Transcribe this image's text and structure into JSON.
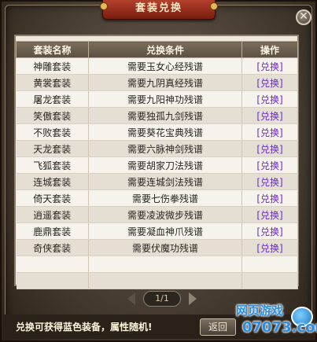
{
  "window": {
    "title": "套装兑换",
    "close_symbol": "✕"
  },
  "table": {
    "headers": [
      "套装名称",
      "兑换条件",
      "操作"
    ],
    "rows": [
      {
        "name": "神雕套装",
        "condition": "需要玉女心经残谱",
        "action": "[兑换]"
      },
      {
        "name": "黄裳套装",
        "condition": "需要九阴真经残谱",
        "action": "[兑换]"
      },
      {
        "name": "屠龙套装",
        "condition": "需要九阳神功残谱",
        "action": "[兑换]"
      },
      {
        "name": "笑傲套装",
        "condition": "需要独孤九剑残谱",
        "action": "[兑换]"
      },
      {
        "name": "不败套装",
        "condition": "需要葵花宝典残谱",
        "action": "[兑换]"
      },
      {
        "name": "天龙套装",
        "condition": "需要六脉神剑残谱",
        "action": "[兑换]"
      },
      {
        "name": "飞狐套装",
        "condition": "需要胡家刀法残谱",
        "action": "[兑换]"
      },
      {
        "name": "连城套装",
        "condition": "需要连城剑法残谱",
        "action": "[兑换]"
      },
      {
        "name": "倚天套装",
        "condition": "需要七伤拳残谱",
        "action": "[兑换]"
      },
      {
        "name": "逍遥套装",
        "condition": "需要凌波微步残谱",
        "action": "[兑换]"
      },
      {
        "name": "鹿鼎套装",
        "condition": "需要凝血神爪残谱",
        "action": "[兑换]"
      },
      {
        "name": "奇侠套装",
        "condition": "需要伏魔功残谱",
        "action": "[兑换]"
      }
    ]
  },
  "pager": {
    "text": "1/1"
  },
  "footer": {
    "note": "兑换可获得蓝色装备，属性随机!",
    "return_label": "返回"
  },
  "watermark": {
    "line1": "网页游戏",
    "line2": "07073.com"
  },
  "colors": {
    "accent_title": "#b3402b",
    "link": "#6a2bd1",
    "watermark": "#2b8de0"
  }
}
